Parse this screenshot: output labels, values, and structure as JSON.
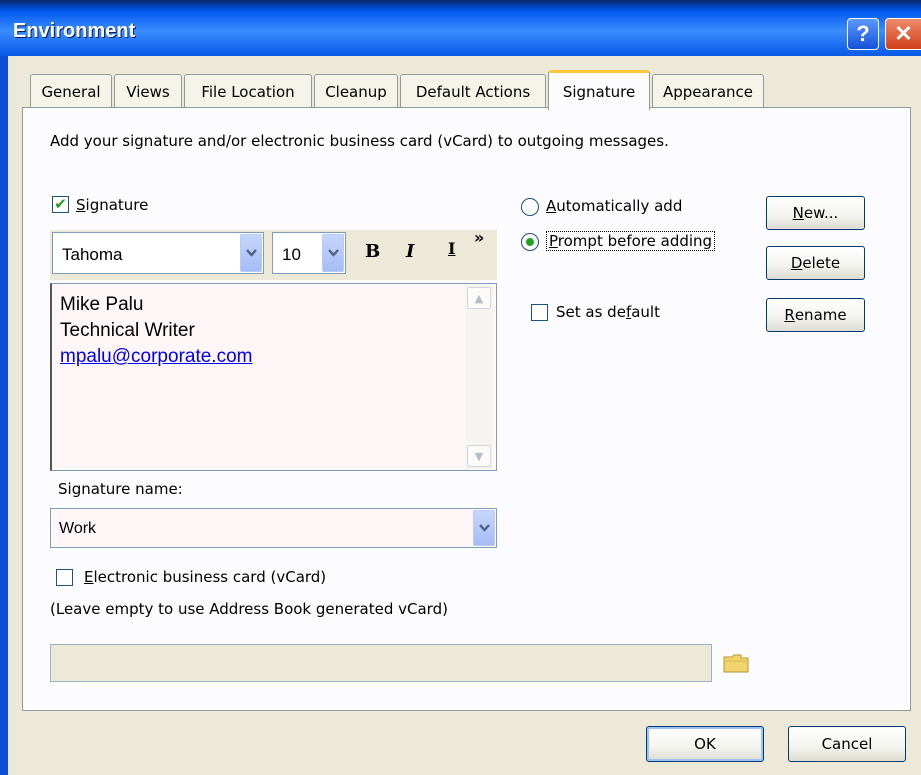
{
  "window": {
    "title": "Environment",
    "help_glyph": "?",
    "close_glyph": "✕"
  },
  "tabs": [
    {
      "label": "General"
    },
    {
      "label": "Views"
    },
    {
      "label": "File Location"
    },
    {
      "label": "Cleanup"
    },
    {
      "label": "Default Actions"
    },
    {
      "label": "Signature",
      "active": true
    },
    {
      "label": "Appearance"
    }
  ],
  "description": "Add your signature and/or electronic business card (vCard) to outgoing messages.",
  "signature_checkbox": {
    "label_first": "S",
    "label_rest": "ignature",
    "checked": true,
    "check_glyph": "✔"
  },
  "toolbar": {
    "font": "Tahoma",
    "size": "10",
    "bold": "B",
    "italic": "I",
    "underline": "I",
    "overflow": "»"
  },
  "editor": {
    "lines": [
      "Mike Palu",
      "Technical Writer"
    ],
    "email": "mpalu@corporate.com",
    "scroll_up_glyph": "▲",
    "scroll_down_glyph": "▼"
  },
  "signature_name": {
    "label": "Signature name:",
    "value": "Work"
  },
  "vcard": {
    "label_first": "E",
    "label_rest": "lectronic business card (vCard)",
    "checked": false,
    "hint": "(Leave empty to use Address Book generated vCard)",
    "value": ""
  },
  "options": {
    "auto_add": {
      "label_first": "A",
      "label_rest": "utomatically add",
      "selected": false
    },
    "prompt": {
      "label_first": "P",
      "label_rest": "rompt before adding",
      "selected": true
    },
    "set_default": {
      "label_a": "Set as de",
      "label_ul": "f",
      "label_b": "ault",
      "checked": false
    }
  },
  "side_buttons": {
    "new": {
      "ul": "N",
      "rest": "ew..."
    },
    "delete": {
      "ul": "D",
      "rest": "elete"
    },
    "rename": {
      "ul": "R",
      "rest": "ename"
    }
  },
  "footer": {
    "ok": "OK",
    "cancel": "Cancel"
  },
  "colors": {
    "titlebar": "#0058ee",
    "dialog_bg": "#ece9d8",
    "active_tab_accent": "#ffc83c",
    "check_green": "#21a121",
    "link": "#0000ee"
  }
}
